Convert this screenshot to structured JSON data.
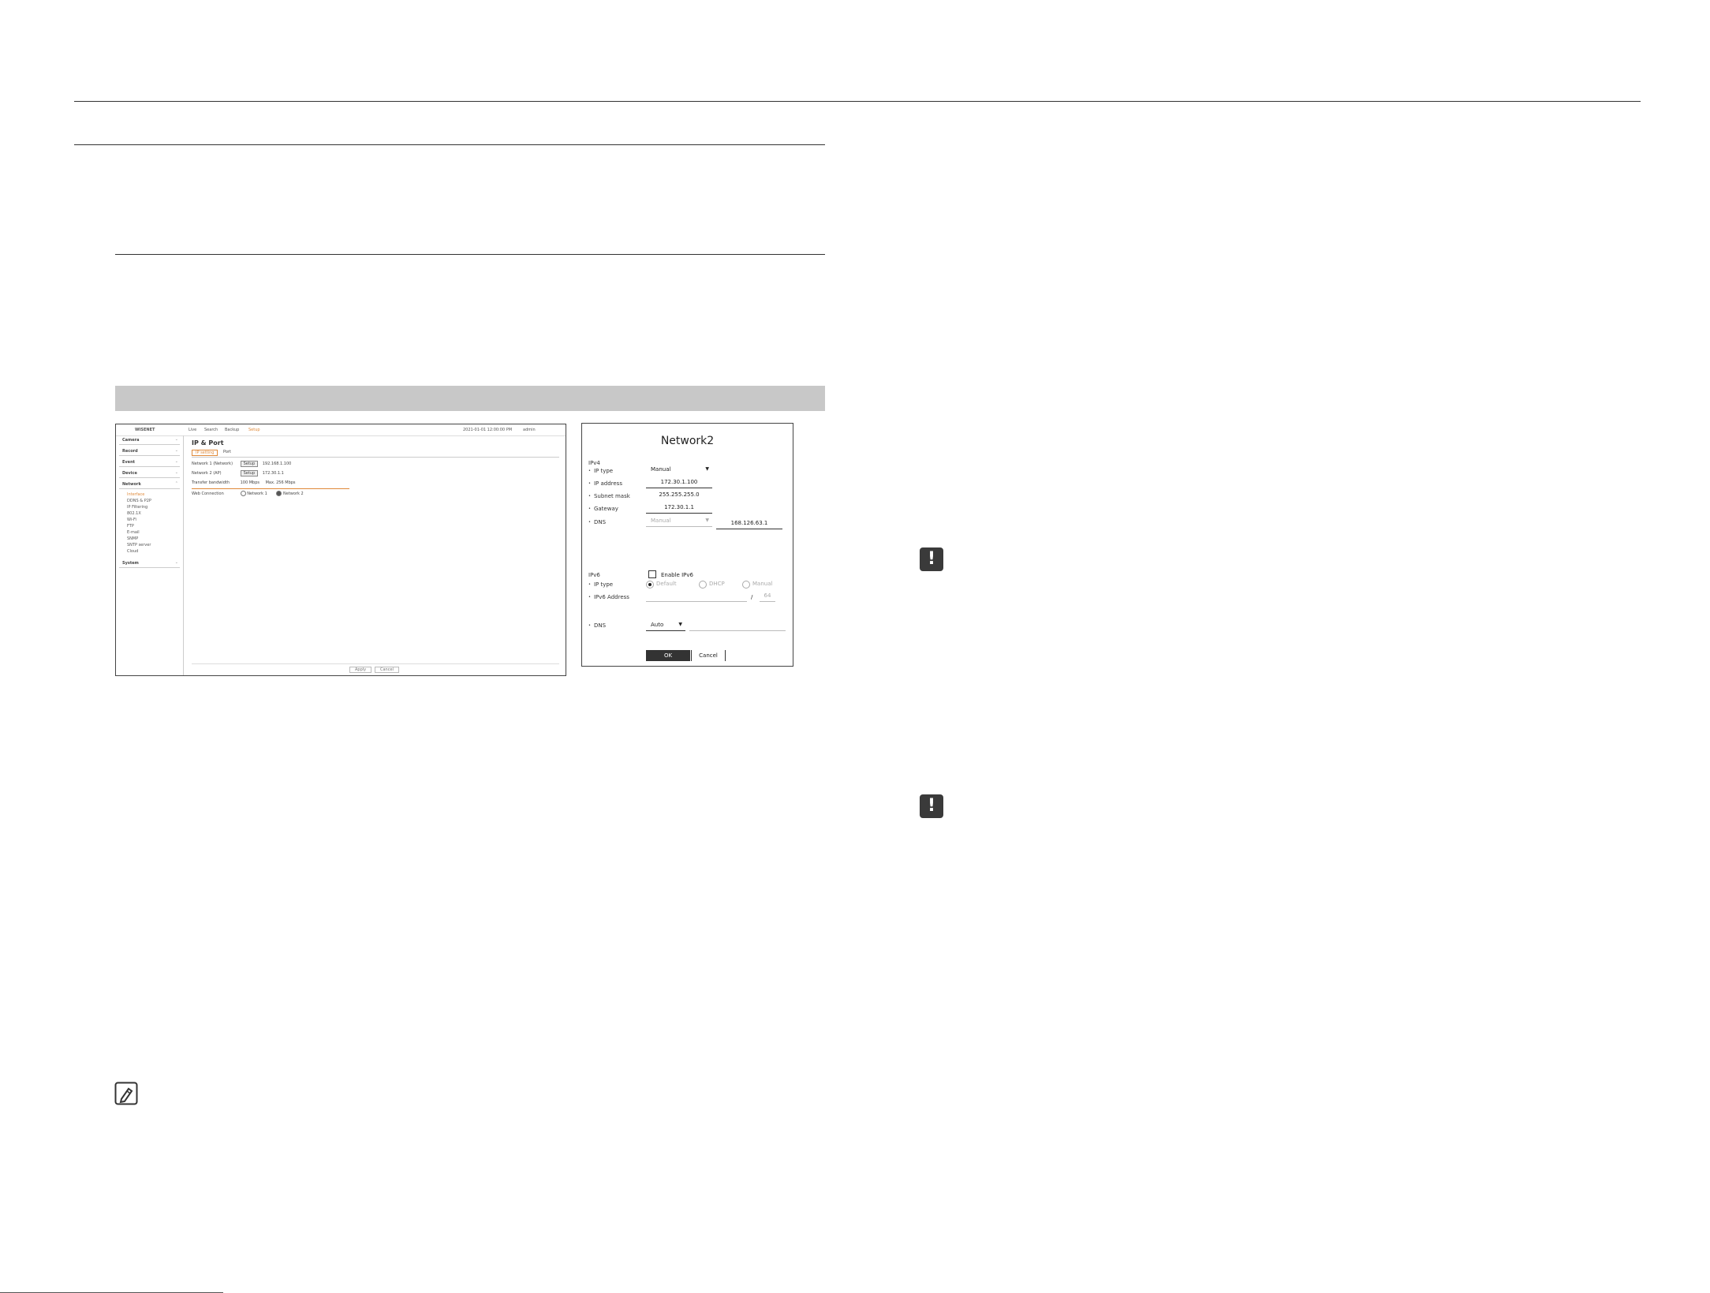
{
  "screenshot": {
    "topbar": {
      "brand": "WISENET",
      "menu": [
        "Live",
        "Search",
        "Backup",
        "Setup"
      ],
      "datetime": "2021-01-01 12:00:00 PM",
      "user": "admin"
    },
    "sidebar": {
      "groups": [
        "Camera",
        "Record",
        "Event",
        "Device",
        "Network"
      ],
      "network_items": [
        "Interface",
        "DDNS & P2P",
        "IP Filtering",
        "802.1X",
        "Wi-Fi",
        "FTP",
        "E-mail",
        "SNMP",
        "SNTP server",
        "Cloud"
      ],
      "last_group": "System"
    },
    "content": {
      "title": "IP & Port",
      "tabs": [
        "IP setting",
        "Port"
      ],
      "rows": [
        {
          "label": "Network 1 (Network)",
          "button": "Setup",
          "value": "192.168.1.100"
        },
        {
          "label": "Network 2 (AP)",
          "button": "Setup",
          "value": "172.30.1.1"
        },
        {
          "label": "Transfer bandwidth",
          "value": "100",
          "unit": "Mbps",
          "extra": "Max. 256 Mbps"
        },
        {
          "label": "Web Connection",
          "options": [
            "Network 1",
            "Network 2"
          ]
        }
      ],
      "footer_buttons": [
        "Apply",
        "Cancel"
      ]
    }
  },
  "dialog": {
    "title": "Network2",
    "ipv4": {
      "section": "IPv4",
      "ip_type_label": "IP type",
      "ip_type_value": "Manual",
      "ip_address_label": "IP address",
      "ip_address": "172.30.1.100",
      "subnet_label": "Subnet mask",
      "subnet": "255.255.255.0",
      "gateway_label": "Gateway",
      "gateway": "172.30.1.1",
      "dns_label": "DNS",
      "dns_mode": "Manual",
      "dns_value": "168.126.63.1"
    },
    "ipv6": {
      "section": "IPv6",
      "enable_label": "Enable IPv6",
      "ip_type_label": "IP type",
      "options": [
        "Default",
        "DHCP",
        "Manual"
      ],
      "address_label": "IPv6 Address",
      "slash": "/",
      "prefix": "64",
      "dns_label": "DNS",
      "dns_mode": "Auto"
    },
    "ok": "OK",
    "cancel": "Cancel"
  },
  "warn_mark": "!"
}
